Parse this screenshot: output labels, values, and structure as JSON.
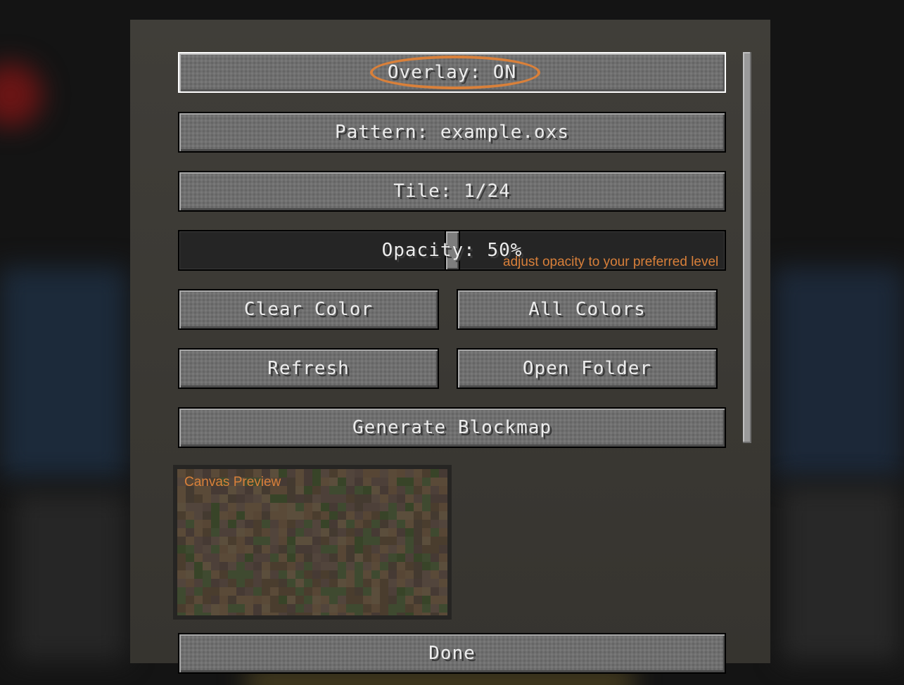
{
  "buttons": {
    "overlay": "Overlay: ON",
    "pattern": "Pattern: example.oxs",
    "tile": "Tile: 1/24",
    "clear_color": "Clear Color",
    "all_colors": "All Colors",
    "refresh": "Refresh",
    "open_folder": "Open Folder",
    "generate_blockmap": "Generate Blockmap",
    "done": "Done"
  },
  "opacity_slider": {
    "label": "Opacity: 50%",
    "value": 0.5,
    "hint": "adjust opacity to your preferred level"
  },
  "canvas_preview": {
    "title": "Canvas Preview"
  },
  "colors": {
    "accent": "#d9803a",
    "button_face": "#6f6f6f",
    "panel": "#3b3a36"
  }
}
